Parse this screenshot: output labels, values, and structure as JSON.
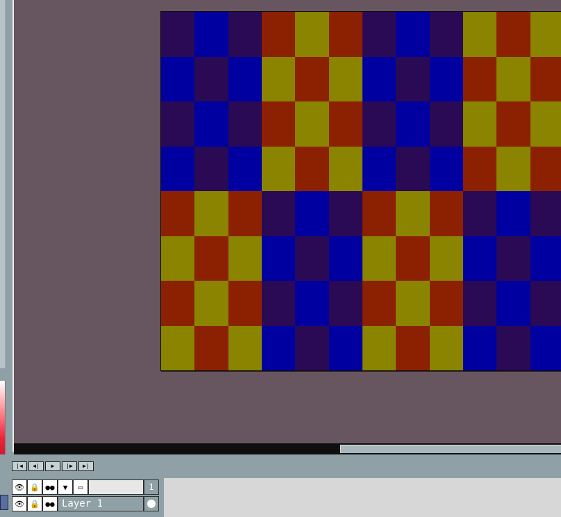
{
  "colors": {
    "canvas_bg": "#67565f",
    "panel_bg": "#8fa1a6",
    "dark_purple": "#2a0a55",
    "blue": "#0000a0",
    "red": "#8b2100",
    "olive": "#8a8400"
  },
  "artwork": {
    "pattern_rows": [
      [
        "P",
        "B",
        "P",
        "R",
        "O",
        "R",
        "P",
        "B",
        "P",
        "O",
        "R",
        "O"
      ],
      [
        "B",
        "P",
        "B",
        "O",
        "R",
        "O",
        "B",
        "P",
        "B",
        "R",
        "O",
        "R"
      ],
      [
        "P",
        "B",
        "P",
        "R",
        "O",
        "R",
        "P",
        "B",
        "P",
        "O",
        "R",
        "O"
      ],
      [
        "B",
        "P",
        "B",
        "O",
        "R",
        "O",
        "B",
        "P",
        "B",
        "R",
        "O",
        "R"
      ],
      [
        "R",
        "O",
        "R",
        "P",
        "B",
        "P",
        "R",
        "O",
        "R",
        "P",
        "B",
        "P"
      ],
      [
        "O",
        "R",
        "O",
        "B",
        "P",
        "B",
        "O",
        "R",
        "O",
        "B",
        "P",
        "B"
      ],
      [
        "R",
        "O",
        "R",
        "P",
        "B",
        "P",
        "R",
        "O",
        "R",
        "P",
        "B",
        "P"
      ],
      [
        "O",
        "R",
        "O",
        "B",
        "P",
        "B",
        "O",
        "R",
        "O",
        "B",
        "P",
        "B"
      ]
    ],
    "legend": {
      "P": "#2a0a55",
      "B": "#0000a0",
      "R": "#8b2100",
      "O": "#8a8400"
    }
  },
  "playback": {
    "first_label": "|◀",
    "prev_label": "◀|",
    "play_label": "▶",
    "next_label": "|▶",
    "last_label": "▶|"
  },
  "layers_header": {
    "icons": [
      "eye-icon",
      "lock-icon",
      "onion-skin-icon",
      "stamp-icon",
      "frame-icon"
    ],
    "eye": "👁",
    "lock": "🔒",
    "onion": "●●",
    "stamp": "▼",
    "frame": "▭",
    "frame_number": "1"
  },
  "layers": [
    {
      "name": "Layer 1",
      "eye": "👁",
      "lock": "🔒",
      "onion": "●●"
    }
  ]
}
